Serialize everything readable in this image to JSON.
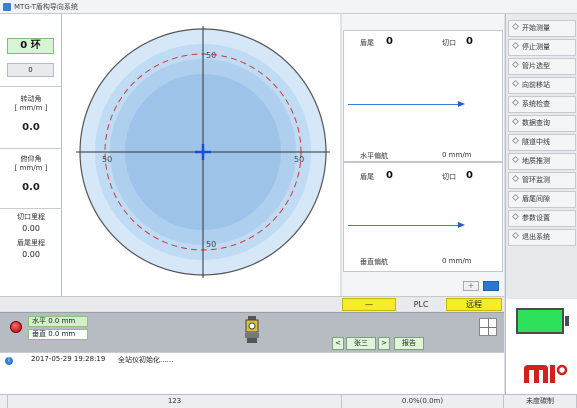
{
  "window": {
    "title": "MTG-T盾构导向系统"
  },
  "left": {
    "ring": "0 环",
    "small_value": "0",
    "rotation_label_1": "转动角",
    "rotation_label_2": "[ mm/m ]",
    "rotation_value": "0.0",
    "pitch_label_1": "俯仰角",
    "pitch_label_2": "[ mm/m ]",
    "pitch_value": "0.0",
    "cut_mileage_label": "切口里程",
    "cut_mileage_value": "0.00",
    "tail_mileage_label": "盾尾里程",
    "tail_mileage_value": "0.00"
  },
  "target": {
    "tick_top": "50",
    "tick_bottom": "50",
    "tick_left": "50",
    "tick_right": "50"
  },
  "horizontal": {
    "tail_label": "盾尾",
    "tail_value": "0",
    "cut_label": "切口",
    "cut_value": "0",
    "deviation_label": "水平偏航",
    "deviation_value": "0 mm/m"
  },
  "vertical": {
    "tail_label": "盾尾",
    "tail_value": "0",
    "cut_label": "切口",
    "cut_value": "0",
    "deviation_label": "垂直偏航",
    "deviation_value": "0 mm/m"
  },
  "mini_buttons": {
    "plus": "+",
    "minus": ""
  },
  "menu": [
    "开始测量",
    "停止测量",
    "管片选型",
    "向前移站",
    "系统检查",
    "数据查询",
    "隧道中线",
    "地质推测",
    "管环监测",
    "盾尾间隙",
    "参数设置",
    "退出系统"
  ],
  "strip": {
    "dash": "—",
    "plc": "PLC",
    "remote": "远程"
  },
  "status": {
    "horizontal_label": "水平",
    "horizontal_value": "0.0 mm",
    "vertical_label": "垂直",
    "vertical_value": "0.0 mm",
    "nav_prev": "<",
    "operator": "张三",
    "nav_next": ">",
    "report": "报告"
  },
  "log": {
    "timestamp": "2017-05-29 19:28:19",
    "message": "全站仪初始化......"
  },
  "bottom": {
    "c1": "",
    "c2": "123",
    "c3": "0.0%(0.0m)",
    "c4": "未度碳制"
  },
  "colors": {
    "accent": "#2a78d4",
    "battery": "#2ee05a",
    "highlight": "#f7ec2a",
    "alert": "#d41f1f"
  }
}
